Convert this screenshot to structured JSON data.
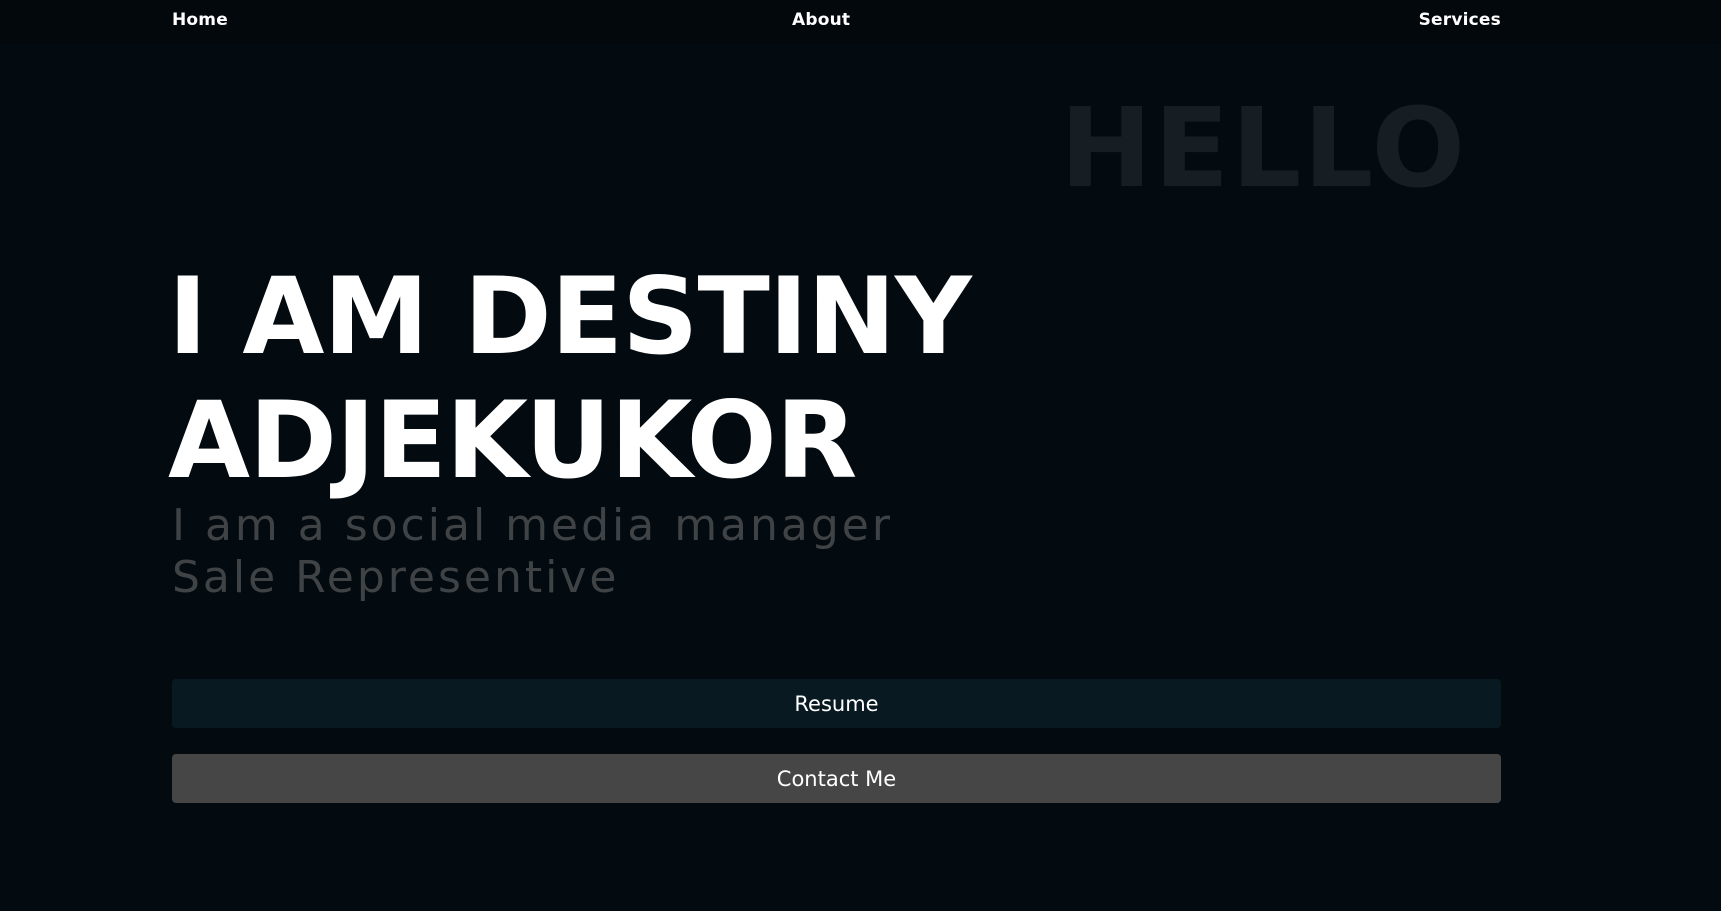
{
  "nav": {
    "home": "Home",
    "about": "About",
    "services": "Services"
  },
  "hero": {
    "background_word": "HELLO",
    "title_line1": "I AM DESTINY",
    "title_line2": "ADJEKUKOR",
    "subtitle_line1": "I am a social media manager",
    "subtitle_line2": "Sale Representive"
  },
  "actions": {
    "resume": "Resume",
    "contact": "Contact Me"
  },
  "colors": {
    "page_background": "#040b10",
    "nav_background": "#02080c",
    "resume_button": "#081922",
    "contact_button": "#464646",
    "subtitle_text": "#3f4346"
  }
}
